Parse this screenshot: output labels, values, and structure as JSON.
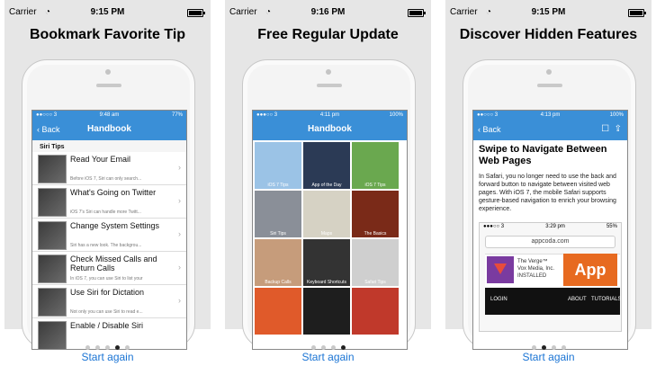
{
  "statusbar": {
    "carrier": "Carrier",
    "times": [
      "9:15 PM",
      "9:16 PM",
      "9:15 PM"
    ]
  },
  "panels": [
    {
      "title": "Bookmark Favorite Tip",
      "screen": {
        "status_left": "●●○○○ 3",
        "status_time": "9:48 am",
        "status_right": "77%",
        "back": "Back",
        "nav_title": "Handbook",
        "section": "Siri Tips",
        "rows": [
          {
            "title": "Read Your Email",
            "sub": "Before iOS 7, Siri can only search..."
          },
          {
            "title": "What's Going on Twitter",
            "sub": "iOS 7's Siri can handle more Twitt..."
          },
          {
            "title": "Change System Settings",
            "sub": "Siri has a new look. The backgrou..."
          },
          {
            "title": "Check Missed Calls and Return Calls",
            "sub": "In iOS 7, you can use Siri to list your"
          },
          {
            "title": "Use Siri for Dictation",
            "sub": "Not only you can use Siri to read e..."
          },
          {
            "title": "Enable / Disable Siri",
            "sub": ""
          }
        ]
      },
      "dots_active": 3
    },
    {
      "title": "Free Regular Update",
      "screen": {
        "status_left": "●●●○○ 3",
        "status_time": "4:11 pm",
        "status_right": "100%",
        "nav_title": "Handbook",
        "tiles": [
          {
            "label": "iOS 7 Tips",
            "color": "#9bc3e6"
          },
          {
            "label": "App of the Day",
            "color": "#2b3a55"
          },
          {
            "label": "iOS 7 Tips",
            "color": "#6aa84f"
          },
          {
            "label": "Siri Tips",
            "color": "#8a8f98"
          },
          {
            "label": "Maps",
            "color": "#d6d2c4"
          },
          {
            "label": "The Basics",
            "color": "#7a2a18"
          },
          {
            "label": "Backup Calls",
            "color": "#c69c7b"
          },
          {
            "label": "Keyboard Shortcuts",
            "color": "#333333"
          },
          {
            "label": "Safari Tips",
            "color": "#cfcfcf"
          },
          {
            "label": "",
            "color": "#e05a2a"
          },
          {
            "label": "",
            "color": "#1e1e1e"
          },
          {
            "label": "",
            "color": "#c0392b"
          }
        ]
      },
      "dots_active": 4
    },
    {
      "title": "Discover Hidden Features",
      "screen": {
        "status_left": "●●○○○ 3",
        "status_time": "4:13 pm",
        "status_right": "100%",
        "back": "Back",
        "article_title": "Swipe to Navigate Between Web Pages",
        "article_body": "In Safari, you no longer need to use the back and forward button to navigate between visited web pages. With iOS 7, the mobile Safari supports gesture-based navigation to enrich your browsing experience.",
        "mini": {
          "carrier": "●●●○○ 3",
          "time": "3:29 pm",
          "battery": "55%",
          "url": "appcoda.com",
          "card_line1": "The Verge™",
          "card_line2": "Vox Media, Inc.",
          "card_line3": "INSTALLED",
          "app": "App",
          "login": "LOGIN",
          "about": "ABOUT",
          "tutorials": "TUTORIALS"
        }
      },
      "dots_active": 2
    }
  ],
  "footer": {
    "start_again": "Start again"
  }
}
